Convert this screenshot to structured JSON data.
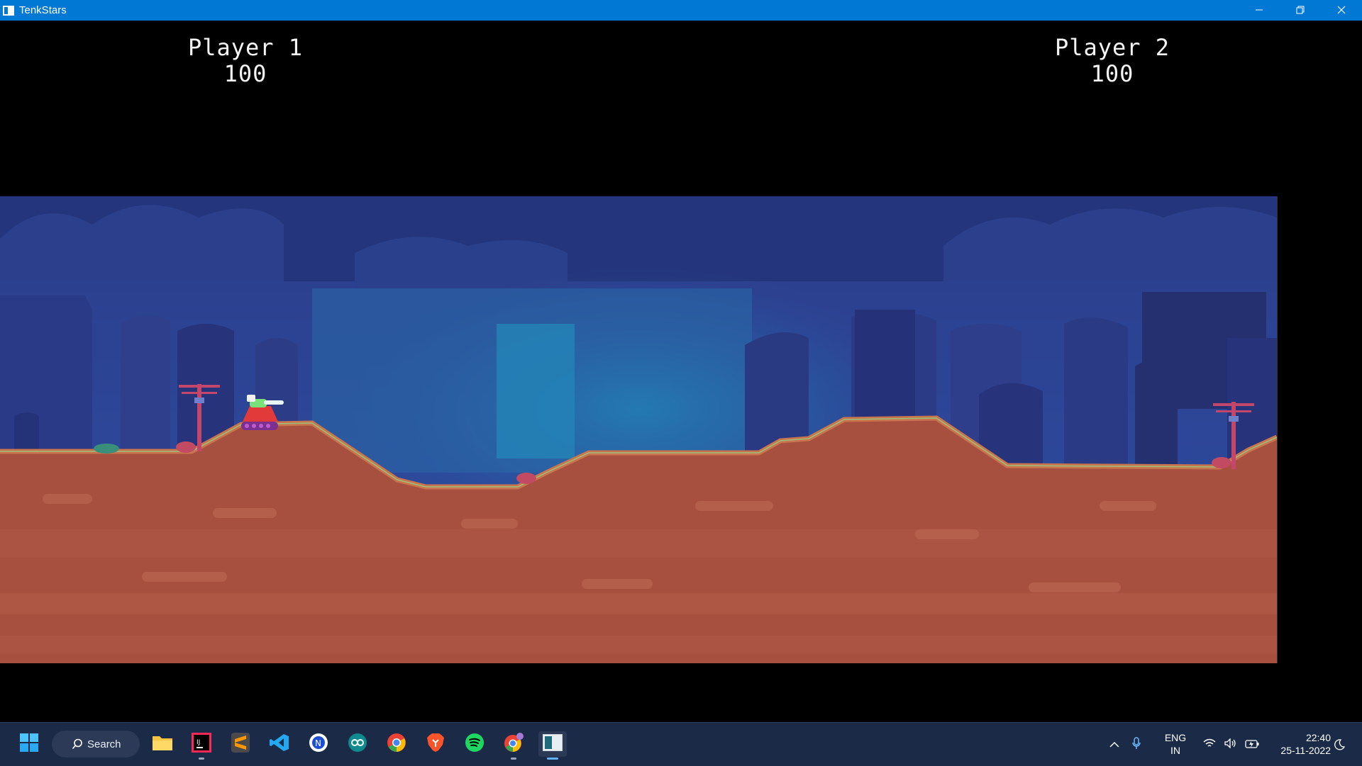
{
  "window": {
    "title": "TenkStars",
    "minimize_icon": "minimize-icon",
    "restore_icon": "restore-icon",
    "close_icon": "close-icon"
  },
  "hud": {
    "player1": {
      "name": "Player 1",
      "health": "100"
    },
    "player2": {
      "name": "Player 2",
      "health": "100"
    }
  },
  "scene": {
    "sky_color": "#2a3f8a",
    "ground_color": "#a85040",
    "terrain_top_color": "#c7744f"
  },
  "taskbar": {
    "search_label": "Search",
    "apps": [
      "start-icon",
      "file-explorer-icon",
      "intellij-icon",
      "sublime-text-icon",
      "vscode-icon",
      "app-icon",
      "arduino-icon",
      "chrome-icon",
      "brave-icon",
      "spotify-icon",
      "chrome-profile-icon",
      "tenkstars-icon"
    ],
    "language": {
      "line1": "ENG",
      "line2": "IN"
    },
    "time": "22:40",
    "date": "25-11-2022"
  }
}
